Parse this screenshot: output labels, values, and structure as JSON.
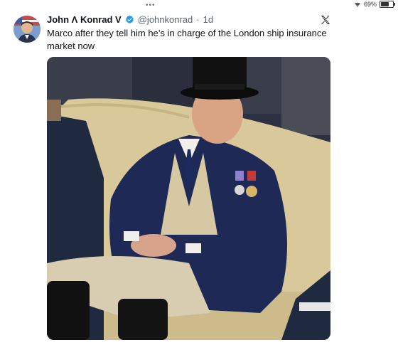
{
  "status_bar": {
    "dots": "•••",
    "battery_text": "69%",
    "battery_level": 0.69,
    "icons": [
      "wifi-icon",
      "battery-icon"
    ]
  },
  "tweet": {
    "author_name": "John Λ Konrad V",
    "handle": "@johnkonrad",
    "separator": "·",
    "time": "1d",
    "text": "Marco after they tell him he’s in charge of the London ship insurance market now",
    "icons": [
      "avatar",
      "verified-badge-icon",
      "x-logo-icon"
    ],
    "verified_color": "#1d9bf0"
  }
}
